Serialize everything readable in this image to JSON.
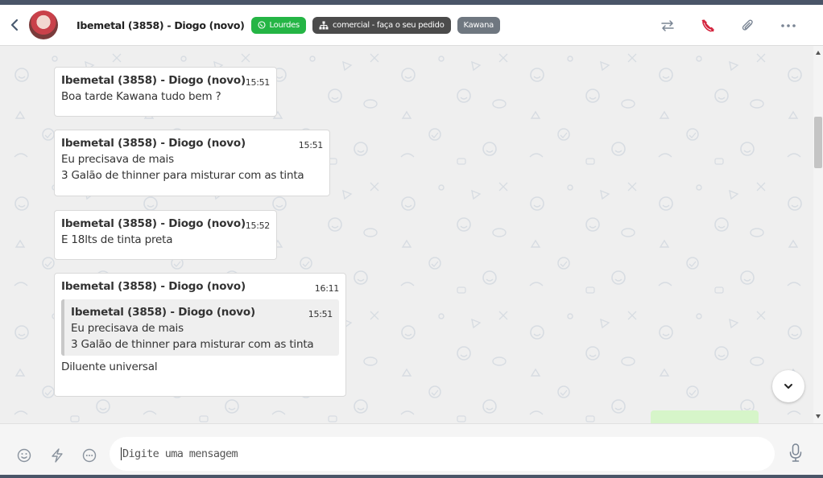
{
  "header": {
    "contact_name": "Ibemetal (3858) - Diogo (novo)",
    "tags": [
      {
        "label": "Lourdes",
        "color": "#25b545",
        "icon": "whatsapp-icon"
      },
      {
        "label": "comercial - faça o seu pedido",
        "color": "#4b4b4b",
        "icon": "sitemap-icon"
      },
      {
        "label": "Kawana",
        "color": "#6f7780",
        "icon": ""
      }
    ],
    "actions": [
      "transfer-icon",
      "end-call-icon",
      "attach-icon",
      "more-icon"
    ]
  },
  "messages": [
    {
      "sender": "Ibemetal (3858) - Diogo (novo)",
      "time": "15:51",
      "lines": [
        "Boa tarde Kawana tudo bem ?"
      ]
    },
    {
      "sender": "Ibemetal (3858) - Diogo (novo)",
      "time": "15:51",
      "lines": [
        "Eu precisava de mais",
        "3 Galão de thinner para misturar com as tinta"
      ]
    },
    {
      "sender": "Ibemetal (3858) - Diogo (novo)",
      "time": "15:52",
      "lines": [
        "E 18lts de tinta preta"
      ]
    },
    {
      "sender": "Ibemetal (3858) - Diogo (novo)",
      "time": "16:11",
      "quote": {
        "sender": "Ibemetal (3858) - Diogo (novo)",
        "time": "15:51",
        "lines": [
          "Eu precisava de mais",
          "3 Galão de thinner para misturar com as tinta"
        ]
      },
      "lines": [
        "Diluente universal"
      ]
    }
  ],
  "composer": {
    "placeholder": "Digite uma mensagem",
    "icons": [
      "emoji-icon",
      "lightning-icon",
      "quick-reply-icon",
      "microphone-icon"
    ]
  },
  "colors": {
    "accent_green": "#25b545",
    "end_call": "#d3203a",
    "own_bubble": "#d6f5c9"
  }
}
